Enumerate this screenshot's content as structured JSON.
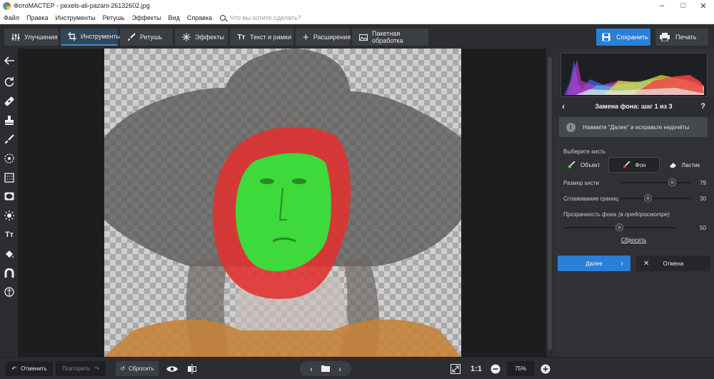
{
  "window": {
    "title": "ФотоМАСТЕР - pexels-ali-pazani-26132602.jpg",
    "minimize": "–",
    "maximize": "□",
    "close": "✕"
  },
  "menu": {
    "items": [
      "Файл",
      "Правка",
      "Инструменты",
      "Ретушь",
      "Эффекты",
      "Вид",
      "Справка"
    ],
    "search_placeholder": "Что вы хотите сделать?"
  },
  "toolbar": {
    "tabs": [
      {
        "label": "Улучшения",
        "icon": "sliders-icon"
      },
      {
        "label": "Инструменты",
        "icon": "crop-icon"
      },
      {
        "label": "Ретушь",
        "icon": "brush-icon"
      },
      {
        "label": "Эффекты",
        "icon": "sparkle-icon"
      },
      {
        "label": "Текст и рамки",
        "icon": "text-icon"
      },
      {
        "label": "Расширения",
        "icon": "plus-icon"
      },
      {
        "label": "Пакетная обработка",
        "icon": "images-icon"
      }
    ],
    "save_label": "Сохранить",
    "print_label": "Печать"
  },
  "panel": {
    "title": "Замена фона: шаг 1 из 3",
    "hint": "Нажмите \"Далее\" и исправьте недочёты",
    "brush_section": "Выберите кисть",
    "brushes": [
      "Объект",
      "Фон",
      "Ластик"
    ],
    "active_brush": "Фон",
    "brush_size_label": "Размер кисти",
    "brush_size_value": "79",
    "smoothing_label": "Сглаживание границ",
    "smoothing_value": "30",
    "opacity_label": "Прозрачность фона",
    "opacity_note": "(в предпросмотре)",
    "opacity_value": "50",
    "reset_link": "Сбросить",
    "next_label": "Далее",
    "cancel_label": "Отмена"
  },
  "bottom": {
    "undo_label": "Отменить",
    "redo_label": "Повторить",
    "reset_label": "Сбросить",
    "fit_label": "1:1",
    "zoom": "75%"
  },
  "colors": {
    "accent": "#2a7fd6",
    "object_mask": "#3ed93a",
    "background_mask": "#e3312f"
  }
}
